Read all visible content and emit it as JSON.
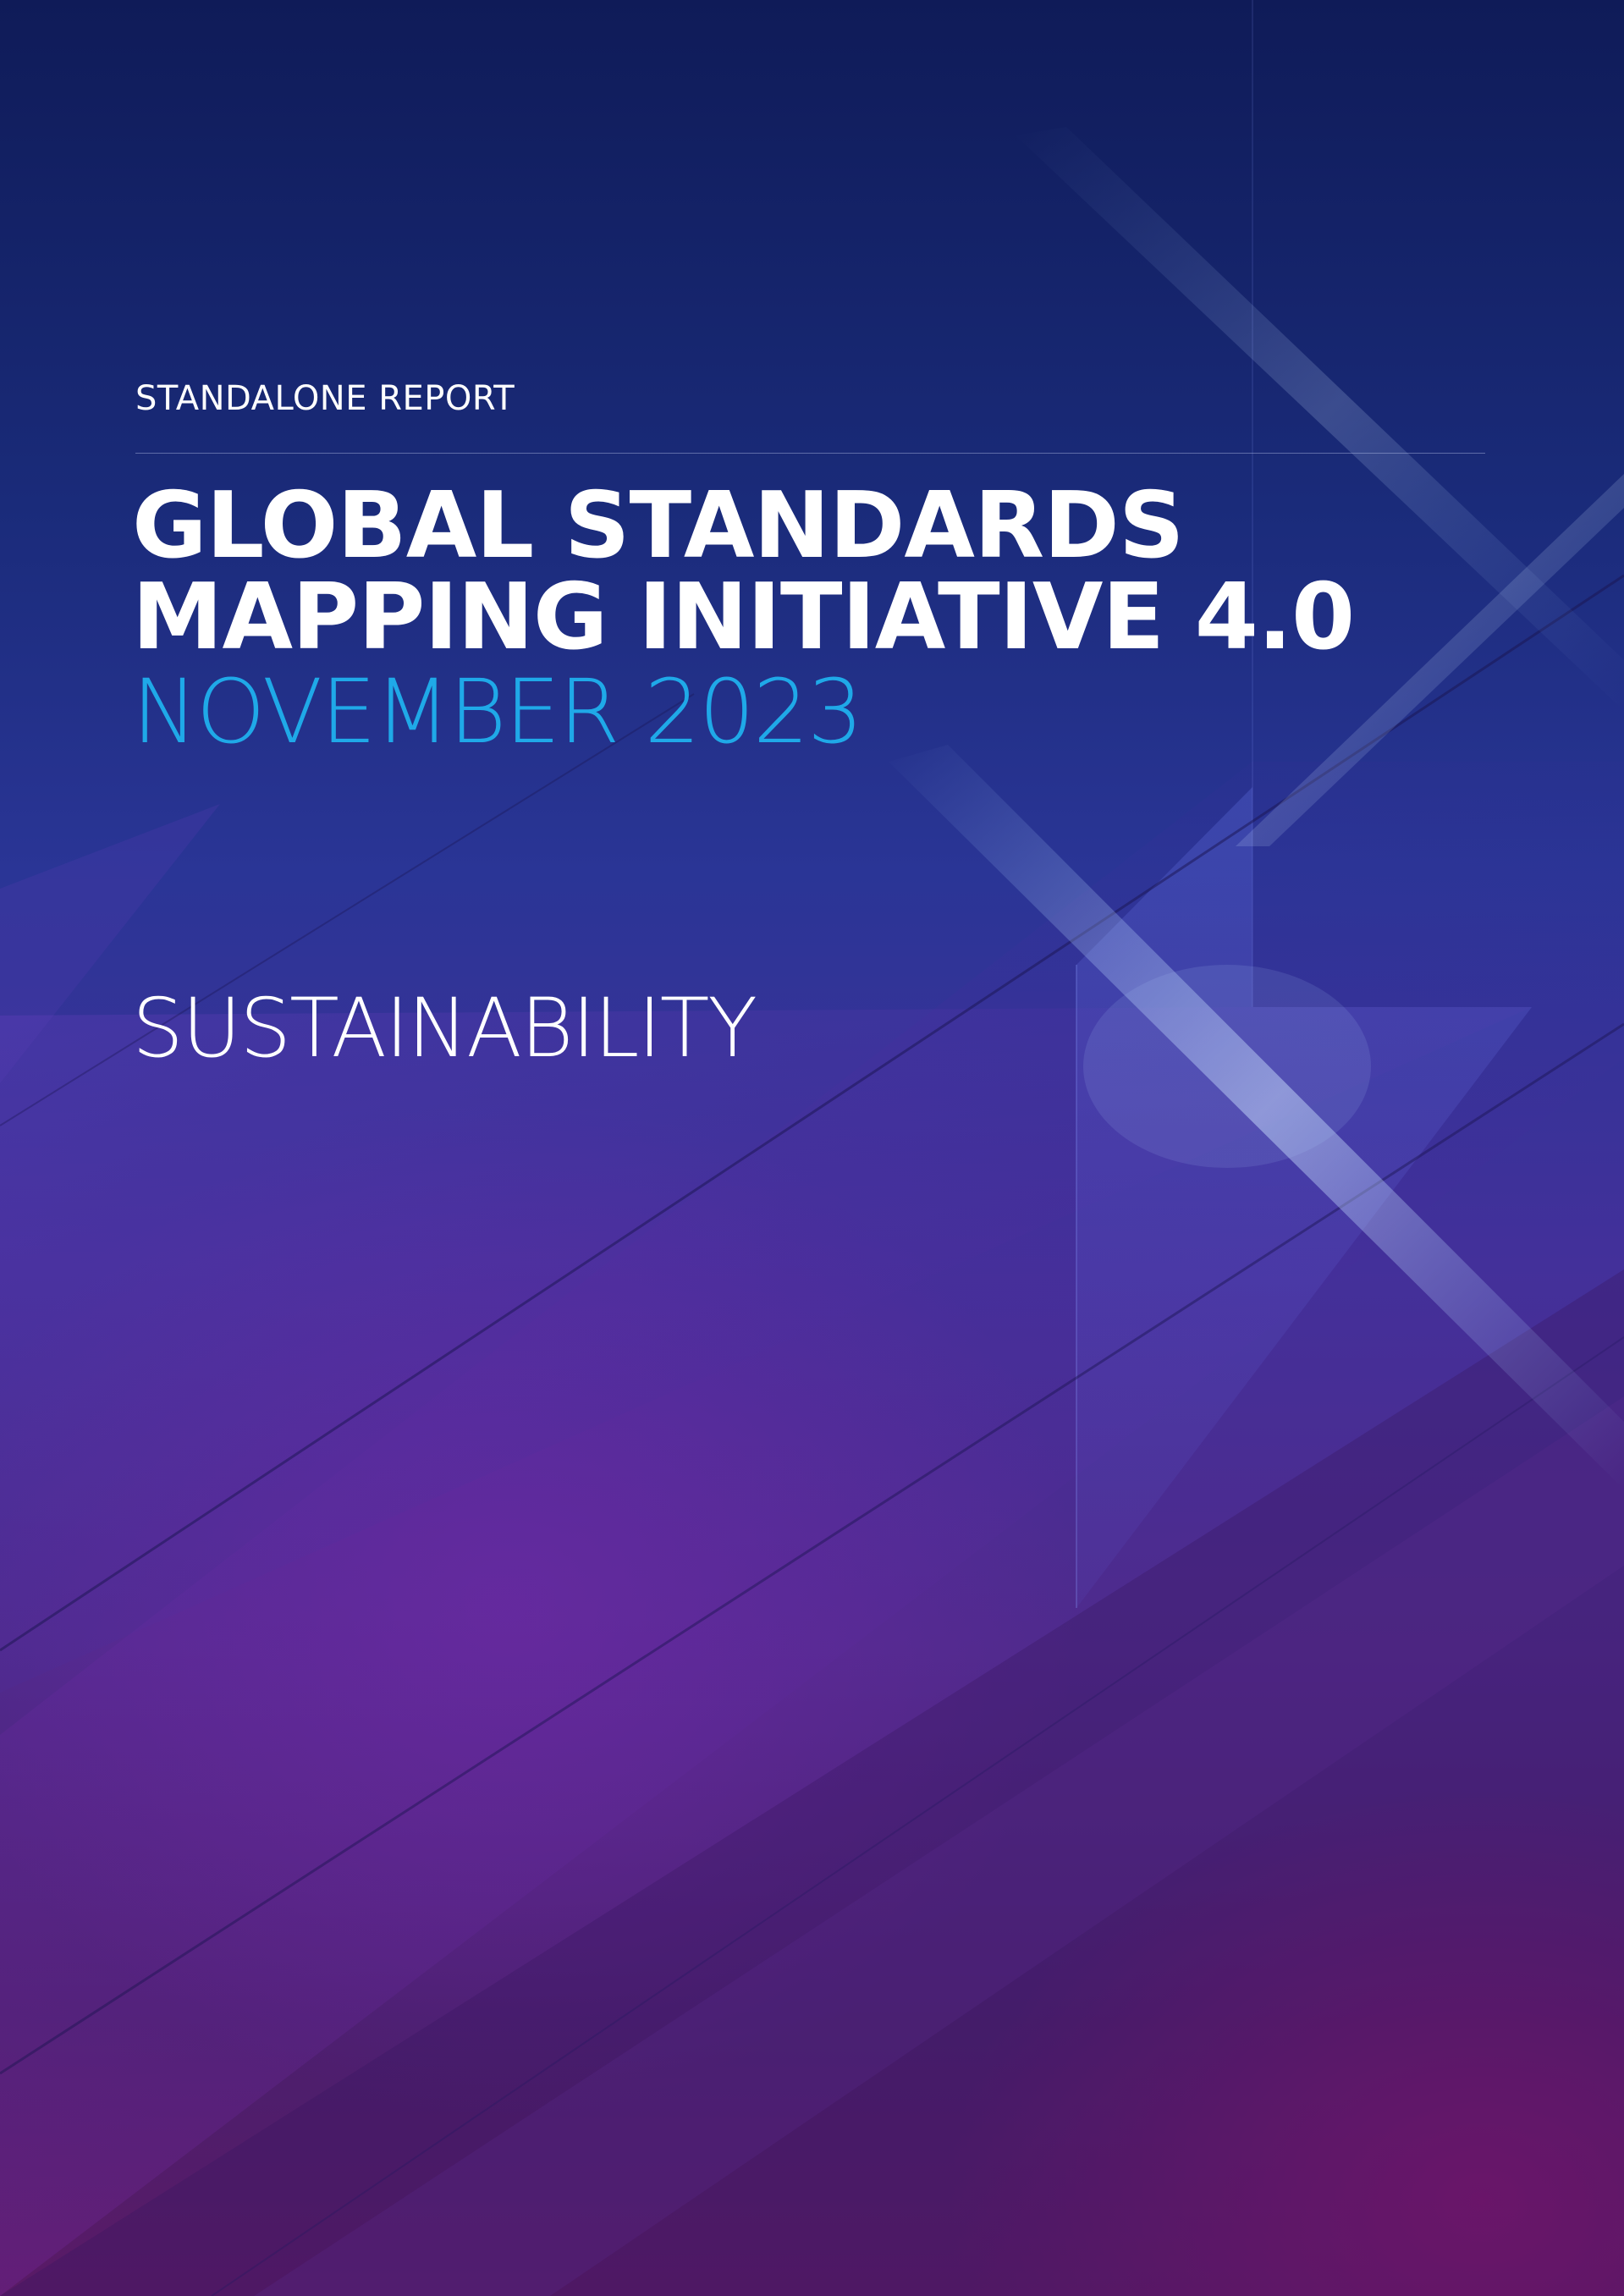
{
  "cover": {
    "eyebrow": "STANDALONE REPORT",
    "title_line_1": "GLOBAL STANDARDS",
    "title_line_2": "MAPPING INITIATIVE 4.0",
    "date": "NOVEMBER 2023",
    "topic": "SUSTAINABILITY"
  },
  "colors": {
    "background_top": "#0f1b58",
    "background_bottom": "#5a1a66",
    "accent_blue": "#1fa9e8",
    "text": "#ffffff"
  }
}
